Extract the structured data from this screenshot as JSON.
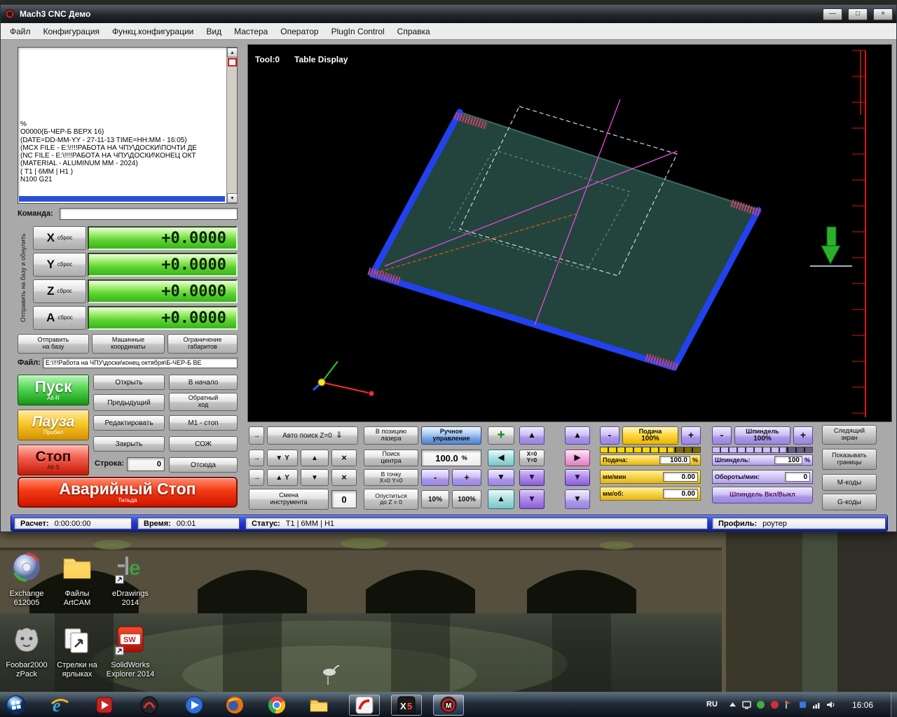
{
  "titlebar": {
    "title": "Mach3 CNC  Демо",
    "min": "—",
    "max": "□",
    "close": "×"
  },
  "menubar": {
    "items": [
      "Файл",
      "Конфигурация",
      "Функц.конфигурации",
      "Вид",
      "Мастера",
      "Оператор",
      "PlugIn Control",
      "Справка"
    ]
  },
  "gcode": {
    "lines": [
      "%",
      "O0000(Б-ЧЕР-Б ВЕРХ 16)",
      "(DATE=DD-MM-YY - 27-11-13 TIME=HH:MM - 16:05)",
      "(MCX FILE - E:\\!!!!РАБОТА НА ЧПУ\\ДОСКИ\\ПОЧТИ ДЕ",
      "(NC FILE - E:\\!!!!РАБОТА НА ЧПУ\\ДОСКИ\\КОНЕЦ ОКТ",
      "(MATERIAL - ALUMINUM MM - 2024)",
      "( T1 | 6MM | H1 )",
      "N100 G21"
    ],
    "command_label": "Команда:",
    "command_value": ""
  },
  "dro": {
    "side_label": "Отправить на базу и обнулить",
    "axes": [
      {
        "letter": "X",
        "sub": "сброс",
        "value": "+0.0000"
      },
      {
        "letter": "Y",
        "sub": "сброс",
        "value": "+0.0000"
      },
      {
        "letter": "Z",
        "sub": "сброс",
        "value": "+0.0000"
      },
      {
        "letter": "A",
        "sub": "сброс",
        "value": "+0.0000"
      }
    ],
    "ref": "Отправить\nна базу",
    "machine": "Машинные\nкоординаты",
    "limits": "Ограничение\nгабаритов"
  },
  "file": {
    "label": "Файл:",
    "path": "E:\\!!!Работа на ЧПУ\\доски\\конец октября\\Б-ЧЕР-Б ВЕ"
  },
  "run": {
    "start": "Пуск",
    "start_sub": "Alt-R",
    "pause": "Пауза",
    "pause_sub": "Пробел",
    "stop": "Стоп",
    "stop_sub": "Alt-S",
    "open": "Открыть",
    "to_start": "В начало",
    "prev": "Предыдущий",
    "reverse": "Обратный\nход",
    "edit": "Редактировать",
    "m1": "M1 - стоп",
    "close": "Закрыть",
    "coolant": "СОЖ",
    "line_label": "Строка:",
    "line_value": "0",
    "from_here": "Отсюда",
    "estop": "Аварийный Стоп",
    "estop_sub": "Тильда"
  },
  "viewport": {
    "tool": "Tool:0",
    "display": "Table Display"
  },
  "panel": {
    "step_icon": "→",
    "drop_icon": "⇓",
    "up_icon": "▲",
    "down_icon": "▼",
    "left_icon": "◀",
    "right_icon": "▶",
    "x_icon": "×",
    "plus": "+",
    "minus": "-",
    "y_label": "Y",
    "auto_z": "Авто поиск Z=0",
    "laser": "В позицию\nлазера",
    "manual": "Ручное\nуправление",
    "center": "Поиск\nцентра",
    "jog_value": "100.0",
    "jog_unit": "%",
    "goto_zero": "В точку\nX=0 Y=0",
    "xy_zero": "X=0\nY=0",
    "down_z": "Опуститься\nдо Z = 0",
    "pct10": "10%",
    "pct100": "100%",
    "tool_change": "Смена\nинструмента",
    "tool_value": "0",
    "feed": {
      "title": "Подача",
      "pct": "100%",
      "label": "Подача:",
      "value": "100.0",
      "unit": "%",
      "mmmin_label": "мм/мин",
      "mmmin": "0.00",
      "mmrev_label": "мм/об:",
      "mmrev": "0.00"
    },
    "spindle": {
      "title": "Шпиндель",
      "pct": "100%",
      "label": "Шпиндель:",
      "value": "100",
      "unit": "%",
      "rpm_label": "Обороты/мин:",
      "rpm": "0",
      "toggle": "Шпиндель Вкл/Выкл"
    },
    "tracking": "Следящий\nэкран",
    "bounds": "Показывать\nграницы",
    "mcodes": "М-коды",
    "gcodes": "G-коды"
  },
  "statusbar": {
    "calc_label": "Расчет:",
    "calc": "0:00:00:00",
    "time_label": "Время:",
    "time": "00:01",
    "status_label": "Статус:",
    "status": "T1 | 6MM | H1",
    "profile_label": "Профиль:",
    "profile": "роутер"
  },
  "desktop": {
    "icons": [
      {
        "label": "Exchange\n612005"
      },
      {
        "label": "Файлы\nArtCAM"
      },
      {
        "label": "eDrawings\n2014"
      },
      {
        "label": "Foobar2000\nzPack"
      },
      {
        "label": "Стрелки на\nярлыках"
      },
      {
        "label": "SolidWorks\nExplorer 2014"
      }
    ]
  },
  "taskbar": {
    "lang": "RU",
    "clock": "16:06"
  }
}
